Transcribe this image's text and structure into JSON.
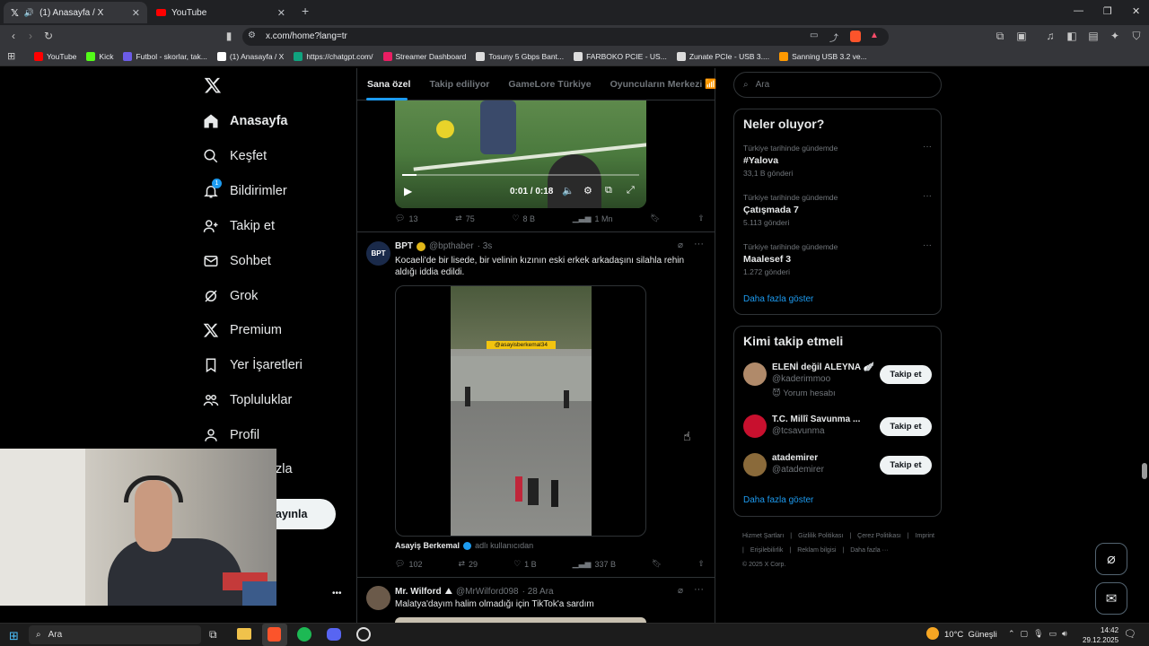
{
  "browser": {
    "tabs": [
      {
        "label": "(1) Anasayfa / X",
        "active": true
      },
      {
        "label": "YouTube",
        "active": false
      }
    ],
    "new_tab": "+",
    "window_controls": {
      "minimize": "—",
      "restore": "❐",
      "close": "✕"
    },
    "url": "x.com/home?lang=tr",
    "bookmarks": [
      {
        "label": "YouTube",
        "color": "#ff0000"
      },
      {
        "label": "Kick",
        "color": "#53fc18"
      },
      {
        "label": "Futbol - skorlar, tak...",
        "color": "#6c5ce7"
      },
      {
        "label": "(1) Anasayfa / X",
        "color": "#ffffff"
      },
      {
        "label": "https://chatgpt.com/",
        "color": "#10a37f"
      },
      {
        "label": "Streamer Dashboard",
        "color": "#e91e63"
      },
      {
        "label": "Tosuny 5 Gbps Bant...",
        "color": "#dddddd"
      },
      {
        "label": "FARBOKO PCIE - US...",
        "color": "#dddddd"
      },
      {
        "label": "Zunate PCIe - USB 3....",
        "color": "#dddddd"
      },
      {
        "label": "Sanning USB 3.2 ve...",
        "color": "#ff9900"
      }
    ]
  },
  "nav": {
    "items": [
      {
        "label": "Anasayfa",
        "icon": "home-icon",
        "active": true
      },
      {
        "label": "Keşfet",
        "icon": "search-icon"
      },
      {
        "label": "Bildirimler",
        "icon": "bell-icon",
        "badge": "1"
      },
      {
        "label": "Takip et",
        "icon": "person-add-icon"
      },
      {
        "label": "Sohbet",
        "icon": "mail-icon"
      },
      {
        "label": "Grok",
        "icon": "grok-icon"
      },
      {
        "label": "Premium",
        "icon": "x-icon"
      },
      {
        "label": "Yer İşaretleri",
        "icon": "bookmark-icon"
      },
      {
        "label": "Topluluklar",
        "icon": "people-icon"
      },
      {
        "label": "Profil",
        "icon": "person-icon"
      }
    ],
    "more_partial": "zla",
    "post_button_partial": "ayınla",
    "account_more": "•••"
  },
  "feed": {
    "tabs": [
      "Sana özel",
      "Takip ediliyor",
      "GameLore Türkiye",
      "Oyuncuların Merkezi 📶"
    ],
    "video1": {
      "time": "0:01 / 0:18",
      "progress": 0.06,
      "actions": {
        "replies": "13",
        "reposts": "75",
        "likes": "8 B",
        "views": "1 Mn"
      }
    },
    "post2": {
      "name": "BPT",
      "handle": "@bpthaber",
      "time": "· 3s",
      "avatar_text": "BPT",
      "text": "Kocaeli'de bir lisede, bir velinin kızının eski erkek arkadaşını silahla rehin aldığı iddia edildi.",
      "media_watermark": "@asayisberkemal34",
      "source_name": "Asayiş Berkemal",
      "source_suffix": "adlı kullanıcıdan",
      "actions": {
        "replies": "102",
        "reposts": "29",
        "likes": "1 B",
        "views": "337 B"
      }
    },
    "post3": {
      "name": "Mr. Wilford",
      "name_emoji": "⛰",
      "handle": "@MrWilford098",
      "time": "· 28 Ara",
      "text": "Malatya'dayım halim olmadığı için TikTok'a sardım"
    }
  },
  "right": {
    "search_placeholder": "Ara",
    "trends_title": "Neler oluyor?",
    "trends": [
      {
        "meta": "Türkiye tarihinde gündemde",
        "name": "#Yalova",
        "count": "33,1 B gönderi"
      },
      {
        "meta": "Türkiye tarihinde gündemde",
        "name": "Çatışmada 7",
        "count": "5.113 gönderi"
      },
      {
        "meta": "Türkiye tarihinde gündemde",
        "name": "Maalesef 3",
        "count": "1.272 gönderi"
      }
    ],
    "trends_more": "Daha fazla göster",
    "trend_menu": "···",
    "who_title": "Kimi takip etmeli",
    "who": [
      {
        "name": "ELENİ değil ALEYNA 🪽",
        "handle": "@kaderimmoo",
        "extra": "😈 Yorum hesabı",
        "button": "Takip et",
        "avatar_color": "#b08a6a"
      },
      {
        "name": "T.C. Millî Savunma ...",
        "handle": "@tcsavunma",
        "button": "Takip et",
        "avatar_color": "#c8102e"
      },
      {
        "name": "atademirer",
        "handle": "@atademirer",
        "button": "Takip et",
        "avatar_color": "#8a6a3a"
      }
    ],
    "who_more": "Daha fazla göster",
    "footer": [
      "Hizmet Şartları",
      "|",
      "Gizlilik Politikası",
      "|",
      "Çerez Politikası",
      "|",
      "Imprint",
      "|",
      "Erişilebilirlik",
      "|",
      "Reklam bilgisi",
      "|",
      "Daha fazla ···",
      "© 2025 X Corp."
    ]
  },
  "taskbar": {
    "search_label": "Ara",
    "weather": "10°C  Güneşli",
    "time": "14:42",
    "date": "29.12.2025"
  },
  "colors": {
    "accent": "#1d9bf0",
    "bg": "#000000",
    "border": "#2f3336",
    "muted": "#71767b"
  }
}
